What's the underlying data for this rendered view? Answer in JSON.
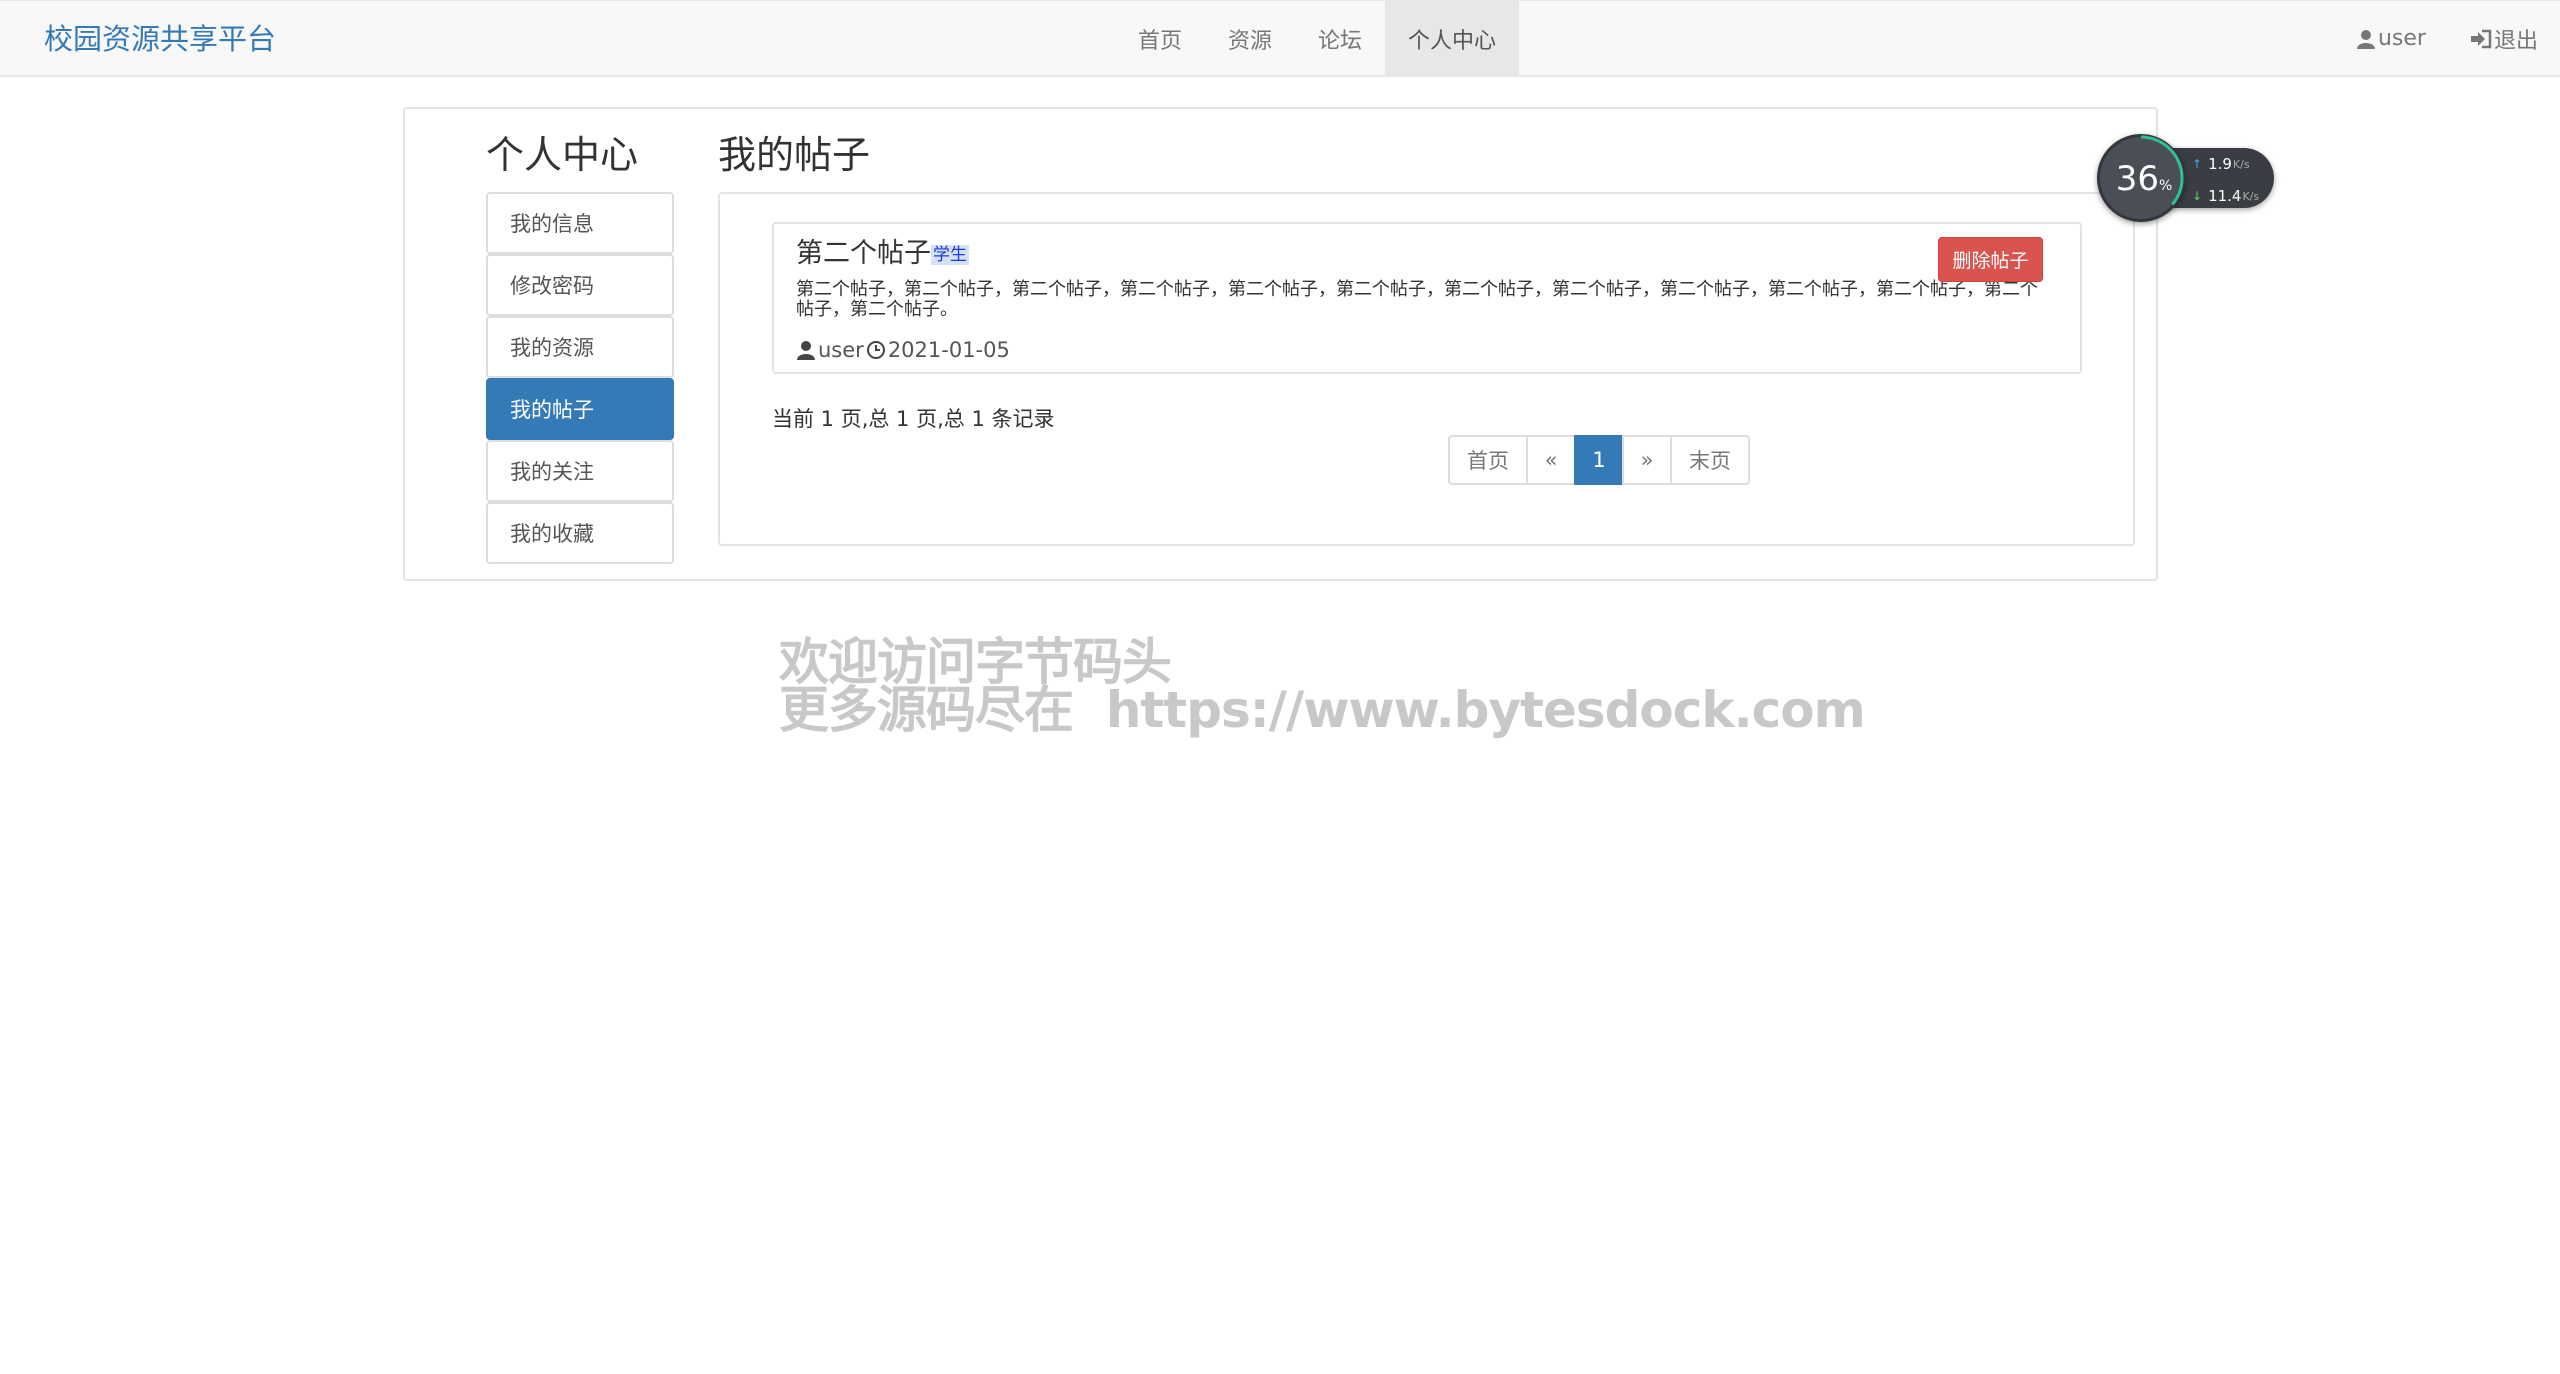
{
  "navbar": {
    "brand": "校园资源共享平台",
    "items": [
      {
        "label": "首页"
      },
      {
        "label": "资源"
      },
      {
        "label": "论坛"
      },
      {
        "label": "个人中心"
      }
    ],
    "user_label": "user",
    "logout_label": "退出"
  },
  "sidebar": {
    "title": "个人中心",
    "items": [
      {
        "label": "我的信息"
      },
      {
        "label": "修改密码"
      },
      {
        "label": "我的资源"
      },
      {
        "label": "我的帖子"
      },
      {
        "label": "我的关注"
      },
      {
        "label": "我的收藏"
      }
    ]
  },
  "main": {
    "title": "我的帖子",
    "post": {
      "title": "第二个帖子",
      "tag": "学生",
      "body": "第二个帖子，第二个帖子，第二个帖子，第二个帖子，第二个帖子，第二个帖子，第二个帖子，第二个帖子，第二个帖子，第二个帖子，第二个帖子，第二个帖子，第二个帖子。",
      "author": "user",
      "date": "2021-01-05",
      "delete_label": "删除帖子"
    },
    "page_info": "当前 1 页,总 1 页,总 1 条记录",
    "pagination": {
      "first": "首页",
      "prev": "«",
      "current": "1",
      "next": "»",
      "last": "末页"
    }
  },
  "net_widget": {
    "percent": "36",
    "percent_unit": "%",
    "up_speed": "1.9",
    "down_speed": "11.4",
    "speed_unit": "K/s"
  },
  "watermark": {
    "line1": "欢迎访问字节码头",
    "line2": "更多源码尽在  https://www.bytesdock.com"
  },
  "colors": {
    "brand": "#337ab7",
    "active": "#337ab7",
    "danger": "#d9534f"
  }
}
